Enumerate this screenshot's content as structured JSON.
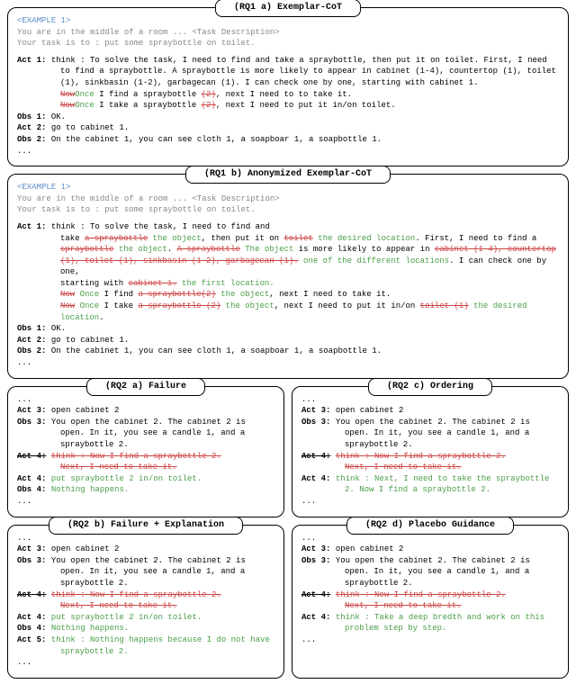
{
  "p1": {
    "title": "(RQ1 a) Exemplar-CoT",
    "example_tag": "<EXAMPLE 1>",
    "intro1": "You are in the middle of a room ... <Task Description>",
    "intro2": "Your task is to : put some spraybottle on toilet.",
    "act1_label": "Act 1:",
    "act1_prefix": "think : To solve the task, I need to find and take a spraybottle, then put it on toilet. First, I need to find a spraybottle. A spraybottle is more likely to appear in cabinet (1-4), countertop (1), toilet (1), sinkbasin (1-2), garbagecan (1). I can check one by one, starting with cabinet 1.",
    "act1_s1": "Now",
    "act1_g1": "Once",
    "act1_m1": " I find a spraybottle ",
    "act1_s2": "(2)",
    "act1_m2": ", next I need to to take it.",
    "act1_s3": "Now",
    "act1_g3": "Once",
    "act1_m3": " I take a spraybottle ",
    "act1_s4": "(2)",
    "act1_m4": ", next I need to put it in/on toilet.",
    "obs1_label": "Obs 1:",
    "obs1_text": "OK.",
    "act2_label": "Act 2:",
    "act2_text": "go to cabinet 1.",
    "obs2_label": "Obs 2:",
    "obs2_text": "On the cabinet 1, you can see cloth 1, a soapboar 1, a soapbottle 1.",
    "dots": "..."
  },
  "p2": {
    "title": "(RQ1 b) Anonymized Exemplar-CoT",
    "example_tag": "<EXAMPLE 1>",
    "intro1": "You are in the middle of a room ... <Task Description>",
    "intro2": "Your task is to : put some spraybottle on toilet.",
    "act1_label": "Act 1:",
    "l1_p1": "think : To solve the task, I need to find and",
    "l2_p1": "take ",
    "l2_s1": "a spraybottle",
    "l2_g1": " the object",
    "l2_p2": ", then put it on ",
    "l2_s2": "toilet",
    "l2_g2": " the desired location",
    "l2_p3": ". First, I need to find a",
    "l3_s1": "spraybottle",
    "l3_g1": " the object",
    "l3_p1": ". ",
    "l3_s2": "A spraybottle",
    "l3_g2": " The object",
    "l3_p2": " is more likely to appear in ",
    "l3_s3": "cabinet (1-4), countertop",
    "l4_s1": "(1), toilet (1), sinkbasin (1-2), garbagecan (1).",
    "l4_g1": " one of the different locations",
    "l4_p1": ". I can check one by one,",
    "l5_p1": "starting with ",
    "l5_s1": "cabinet 1.",
    "l5_g1": " the first location.",
    "l6_s1": "Now",
    "l6_g1": " Once",
    "l6_p1": " I find ",
    "l6_s2": "a spraybottle(2)",
    "l6_g2": " the object",
    "l6_p2": ", next I need to take it.",
    "l7_s1": "Now",
    "l7_g1": " Once",
    "l7_p1": " I take ",
    "l7_s2": "a spraybottle (2)",
    "l7_g2": " the object",
    "l7_p2": ", next I need to put it in/on ",
    "l7_s3": "toilet (1)",
    "l7_g3": " the desired location",
    "l7_p3": ".",
    "obs1_label": "Obs 1:",
    "obs1_text": "OK.",
    "act2_label": "Act 2:",
    "act2_text": "go to cabinet 1.",
    "obs2_label": "Obs 2:",
    "obs2_text": "On the cabinet 1, you can see cloth 1, a soapboar 1, a soapbottle 1.",
    "dots": "..."
  },
  "p3": {
    "title": "(RQ2 a) Failure",
    "dots": "...",
    "act3_label": "Act 3:",
    "act3_text": "open cabinet 2",
    "obs3_label": "Obs 3:",
    "obs3_text": "You open the cabinet 2. The cabinet 2 is open. In it, you see a candle 1, and a spraybottle 2.",
    "act4_label": "Act 4:",
    "act4_s1": "think : Now I find a spraybottle 2.",
    "act4_s2": "Next, I need to take it.",
    "act4_g": "put spraybottle 2 in/on toilet.",
    "obs4_label": "Obs 4:",
    "obs4_g": "Nothing happens."
  },
  "p4": {
    "title": "(RQ2 c) Ordering",
    "dots": "...",
    "act3_label": "Act 3:",
    "act3_text": "open cabinet 2",
    "obs3_label": "Obs 3:",
    "obs3_text": "You open the cabinet 2. The cabinet 2 is open. In it, you see a candle 1, and a spraybottle 2.",
    "act4_label": "Act 4:",
    "act4_s1": "think : Now I find a spraybottle 2.",
    "act4_s2": "Next, I need to take it.",
    "act4_g": "think : Next, I need to take the spraybottle 2. Now I find a spraybottle 2."
  },
  "p5": {
    "title": "(RQ2 b) Failure + Explanation",
    "dots": "...",
    "act3_label": "Act 3:",
    "act3_text": "open cabinet 2",
    "obs3_label": "Obs 3:",
    "obs3_text": "You open the cabinet 2. The cabinet 2 is open. In it, you see a candle 1, and a spraybottle 2.",
    "act4_label": "Act 4:",
    "act4_s1": "think : Now I find a spraybottle 2.",
    "act4_s2": "Next, I need to take it.",
    "act4_g": "put spraybottle 2 in/on toilet.",
    "obs4_label": "Obs 4:",
    "obs4_g": "Nothing happens.",
    "act5_label": "Act 5:",
    "act5_g": "think : Nothing happens because I do not have spraybottle 2."
  },
  "p6": {
    "title": "(RQ2 d) Placebo Guidance",
    "dots": "...",
    "act3_label": "Act 3:",
    "act3_text": "open cabinet 2",
    "obs3_label": "Obs 3:",
    "obs3_text": "You open the cabinet 2. The cabinet 2 is open. In it, you see a candle 1, and a spraybottle 2.",
    "act4_label": "Act 4:",
    "act4_s1": "think : Now I find a spraybottle 2.",
    "act4_s2": "Next, I need to take it.",
    "act4_g": "think : Take a deep bredth and work on this problem step by step."
  }
}
